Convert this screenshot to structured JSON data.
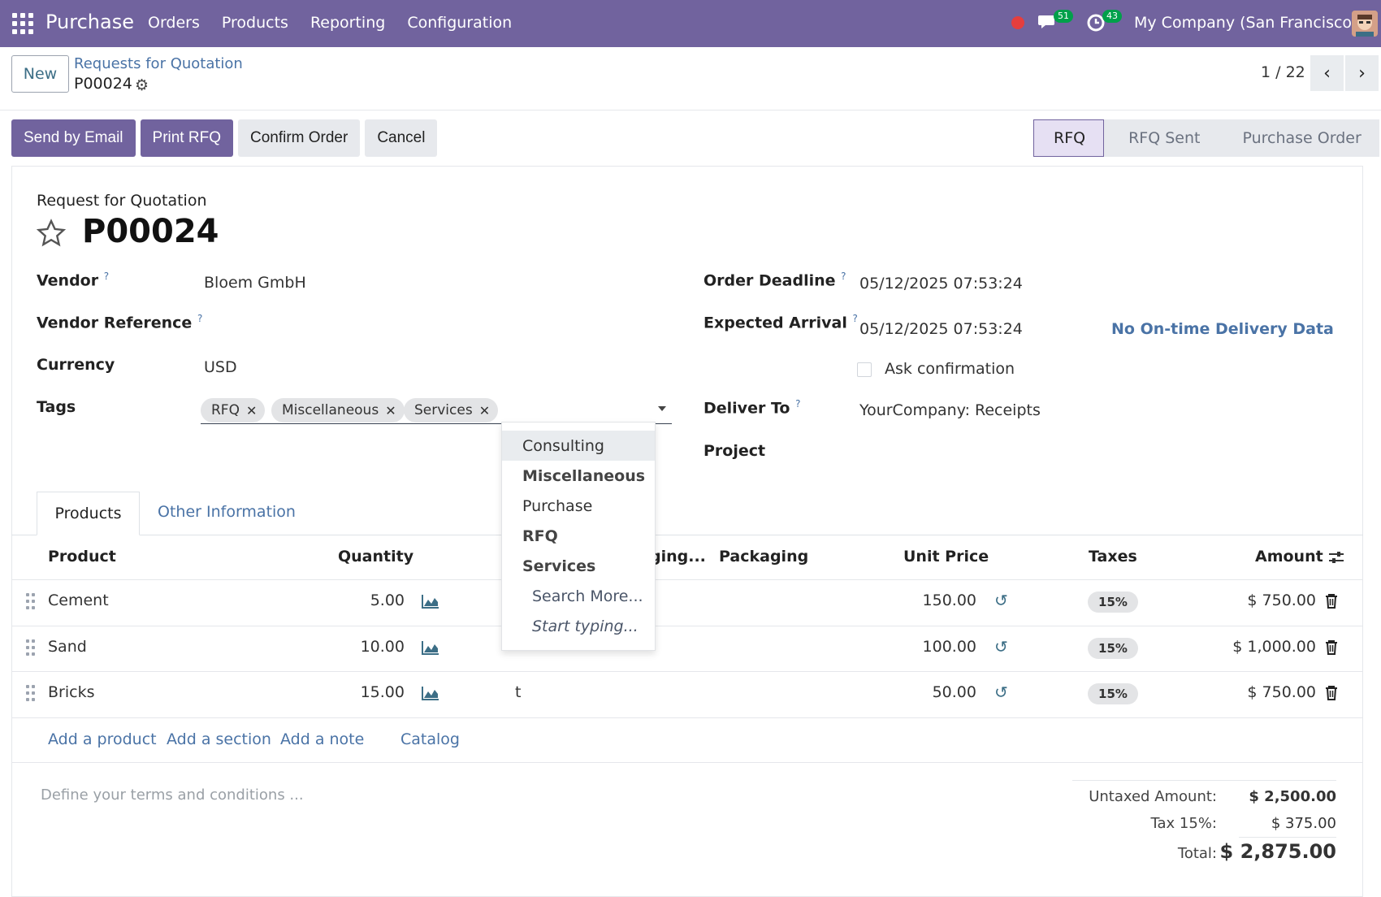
{
  "nav": {
    "app_name": "Purchase",
    "menu": [
      "Orders",
      "Products",
      "Reporting",
      "Configuration"
    ],
    "messages_count": "51",
    "activities_count": "43",
    "company": "My Company (San Francisco)",
    "colors": {
      "brand": "#71639e",
      "badge": "#00a04a",
      "status_dot": "#e53e3e"
    }
  },
  "control": {
    "new_label": "New",
    "breadcrumb_parent": "Requests for Quotation",
    "breadcrumb_current": "P00024",
    "pager": "1 / 22"
  },
  "actions": {
    "send_email": "Send by Email",
    "print_rfq": "Print RFQ",
    "confirm": "Confirm Order",
    "cancel": "Cancel"
  },
  "status": [
    "RFQ",
    "RFQ Sent",
    "Purchase Order"
  ],
  "form": {
    "doc_type": "Request for Quotation",
    "name": "P00024",
    "vendor_label": "Vendor",
    "vendor": "Bloem GmbH",
    "vendor_ref_label": "Vendor Reference",
    "currency_label": "Currency",
    "currency": "USD",
    "tags_label": "Tags",
    "tags": [
      "RFQ",
      "Miscellaneous",
      "Services"
    ],
    "order_deadline_label": "Order Deadline",
    "order_deadline": "05/12/2025 07:53:24",
    "expected_arrival_label": "Expected Arrival",
    "expected_arrival": "05/12/2025 07:53:24",
    "on_time": "No On-time Delivery Data",
    "ask_confirmation": "Ask confirmation",
    "deliver_to_label": "Deliver To",
    "deliver_to": "YourCompany: Receipts",
    "project_label": "Project",
    "help_mark": "?"
  },
  "dropdown": {
    "items": [
      "Consulting",
      "Miscellaneous",
      "Purchase",
      "RFQ",
      "Services"
    ],
    "search_more": "Search More...",
    "start_typing": "Start typing..."
  },
  "tabs": [
    "Products",
    "Other Information"
  ],
  "table": {
    "headers": [
      "Product",
      "Quantity",
      "ging...",
      "Packaging",
      "Unit Price",
      "Taxes",
      "Amount"
    ],
    "rows": [
      {
        "product": "Cement",
        "qty": "5.00",
        "pack_qty": "",
        "unit_price": "150.00",
        "tax": "15%",
        "amount": "$ 750.00"
      },
      {
        "product": "Sand",
        "qty": "10.00",
        "pack_qty": "",
        "unit_price": "100.00",
        "tax": "15%",
        "amount": "$ 1,000.00"
      },
      {
        "product": "Bricks",
        "qty": "15.00",
        "pack_qty": "t",
        "unit_price": "50.00",
        "tax": "15%",
        "amount": "$ 750.00"
      }
    ],
    "add_product": "Add a product",
    "add_section": "Add a section",
    "add_note": "Add a note",
    "catalog": "Catalog"
  },
  "terms_placeholder": "Define your terms and conditions ...",
  "totals": {
    "untaxed_label": "Untaxed Amount:",
    "untaxed": "$ 2,500.00",
    "tax_label": "Tax 15%:",
    "tax": "$ 375.00",
    "total_label": "Total:",
    "total": "$ 2,875.00"
  }
}
